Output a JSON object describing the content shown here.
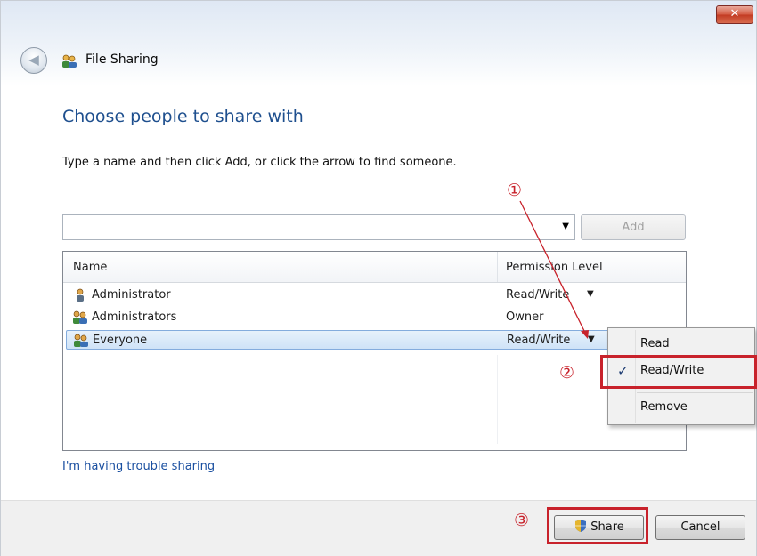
{
  "window": {
    "title": "File Sharing",
    "close_label": "✕"
  },
  "main": {
    "heading": "Choose people to share with",
    "instructions": "Type a name and then click Add, or click the arrow to find someone.",
    "name_input": {
      "value": "",
      "placeholder": ""
    },
    "add_label": "Add",
    "columns": [
      "Name",
      "Permission Level"
    ],
    "rows": [
      {
        "name": "Administrator",
        "permission": "Read/Write",
        "has_dropdown": true,
        "icon": "user-icon"
      },
      {
        "name": "Administrators",
        "permission": "Owner",
        "has_dropdown": false,
        "icon": "group-icon"
      },
      {
        "name": "Everyone",
        "permission": "Read/Write",
        "has_dropdown": true,
        "icon": "group-icon",
        "selected": true
      }
    ],
    "trouble_link": "I'm having trouble sharing"
  },
  "context_menu": {
    "items": [
      "Read",
      "Read/Write",
      "Remove"
    ],
    "checked": "Read/Write"
  },
  "footer": {
    "share_label": "Share",
    "cancel_label": "Cancel"
  },
  "annotations": {
    "markers": [
      "①",
      "②",
      "③"
    ],
    "color": "#c8222b"
  },
  "colors": {
    "heading": "#1e4f8e",
    "link": "#1a4fa0",
    "selection": "#cfe3f7"
  }
}
